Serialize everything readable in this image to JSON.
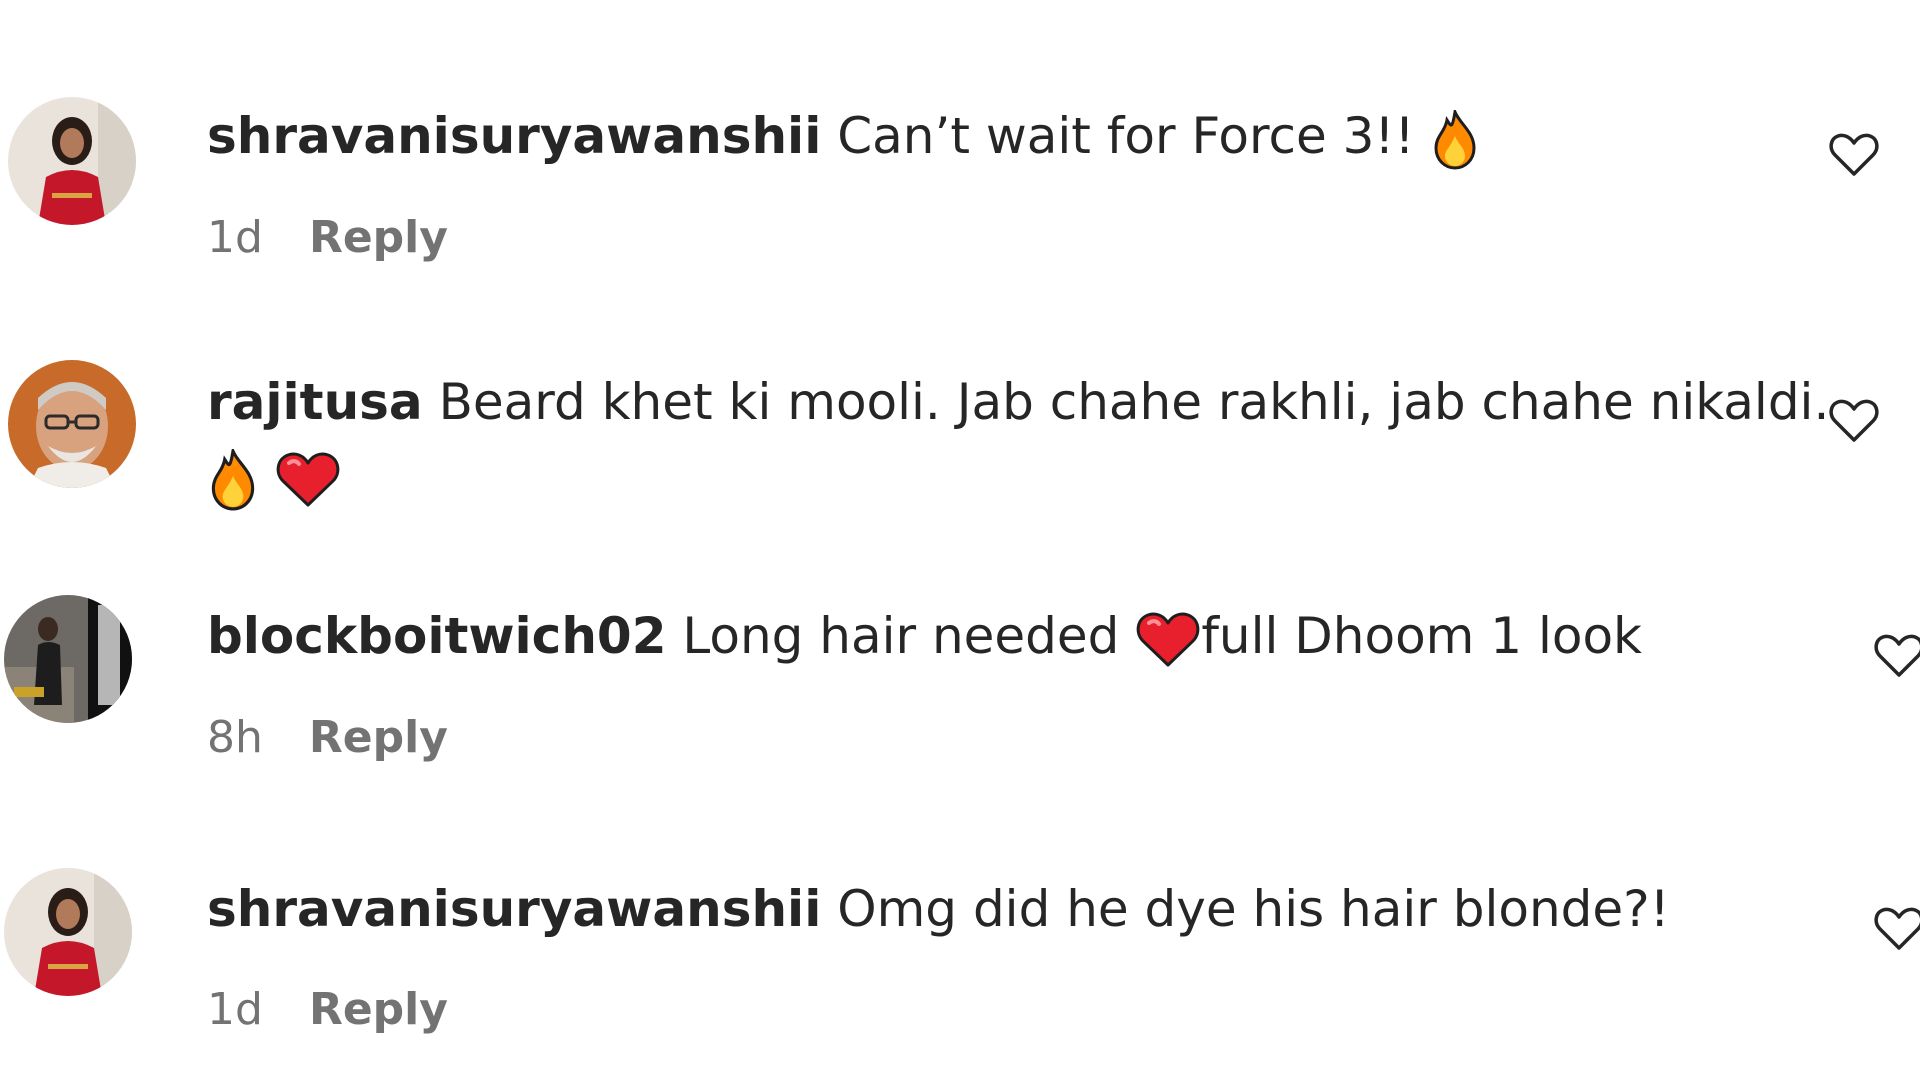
{
  "comments": [
    {
      "username": "shravanisuryawanshii",
      "text": "Can’t wait for Force 3!!",
      "emojis": [
        "fire-emoji"
      ],
      "time": "1d",
      "reply_label": "Reply",
      "avatar": "woman-red-dress-avatar"
    },
    {
      "username": "rajitusa",
      "text": "Beard khet ki mooli. Jab chahe rakhli, jab chahe nikaldi.",
      "emojis": [
        "fire-emoji",
        "heart-emoji"
      ],
      "avatar": "man-glasses-avatar"
    },
    {
      "username": "blockboitwich02",
      "text_before": "Long hair needed",
      "text_after": "full Dhoom 1 look",
      "emojis": [
        "heart-emoji"
      ],
      "time": "8h",
      "reply_label": "Reply",
      "avatar": "photo-avatar"
    },
    {
      "username": "shravanisuryawanshii",
      "text": "Omg did he dye his hair blonde?!",
      "time": "1d",
      "reply_label": "Reply",
      "avatar": "woman-red-dress-avatar"
    }
  ],
  "icons": {
    "like": "heart-outline-icon"
  },
  "colors": {
    "text": "#262626",
    "secondary": "#737373",
    "background": "#ffffff",
    "heart_emoji": "#e8202e",
    "fire_emoji": "#ff8a00"
  }
}
